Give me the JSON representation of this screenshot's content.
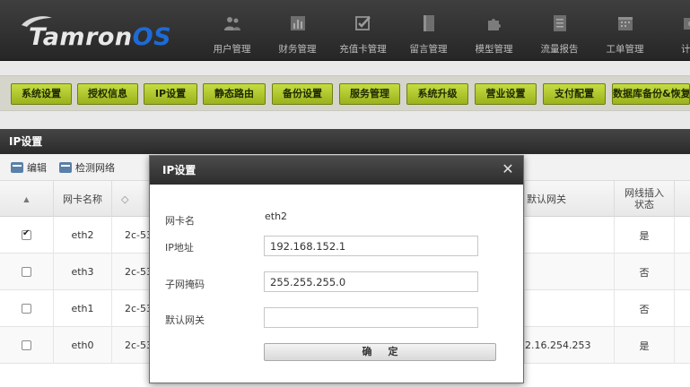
{
  "logo": {
    "main": "Tamron",
    "accent": "OS"
  },
  "nav": [
    {
      "label": "用户管理",
      "icon": "users-icon"
    },
    {
      "label": "财务管理",
      "icon": "chart-icon"
    },
    {
      "label": "充值卡管理",
      "icon": "checkbox-icon"
    },
    {
      "label": "留言管理",
      "icon": "book-icon"
    },
    {
      "label": "模型管理",
      "icon": "puzzle-icon"
    },
    {
      "label": "流量报告",
      "icon": "report-icon"
    },
    {
      "label": "工单管理",
      "icon": "calendar-icon"
    },
    {
      "label": "计费",
      "icon": "billing-icon"
    }
  ],
  "subnav": [
    "系统设置",
    "授权信息",
    "IP设置",
    "静态路由",
    "备份设置",
    "服务管理",
    "系统升级",
    "营业设置",
    "支付配置",
    "数据库备份&恢复"
  ],
  "panel": {
    "title": "IP设置",
    "edit_label": "编辑",
    "check_label": "检测网络"
  },
  "table": {
    "headers": {
      "sort": "▲",
      "name": "网卡名称",
      "mac": "◇",
      "gateway": "默认网关",
      "cable_line1": "网线插入",
      "cable_line2": "状态"
    },
    "rows": [
      {
        "checked": true,
        "name": "eth2",
        "mac": "2c-53",
        "gateway": "",
        "cable": "是"
      },
      {
        "checked": false,
        "name": "eth3",
        "mac": "2c-53",
        "gateway": "",
        "cable": "否"
      },
      {
        "checked": false,
        "name": "eth1",
        "mac": "2c-53",
        "gateway": "",
        "cable": "否"
      },
      {
        "checked": false,
        "name": "eth0",
        "mac": "2c-53",
        "gateway": "2.16.254.253",
        "cable": "是"
      }
    ]
  },
  "modal": {
    "title": "IP设置",
    "close": "✕",
    "nic_label": "网卡名",
    "nic_value": "eth2",
    "ip_label": "IP地址",
    "ip_value": "192.168.152.1",
    "mask_label": "子网掩码",
    "mask_value": "255.255.255.0",
    "gateway_label": "默认网关",
    "gateway_value": "",
    "confirm": "确定"
  }
}
